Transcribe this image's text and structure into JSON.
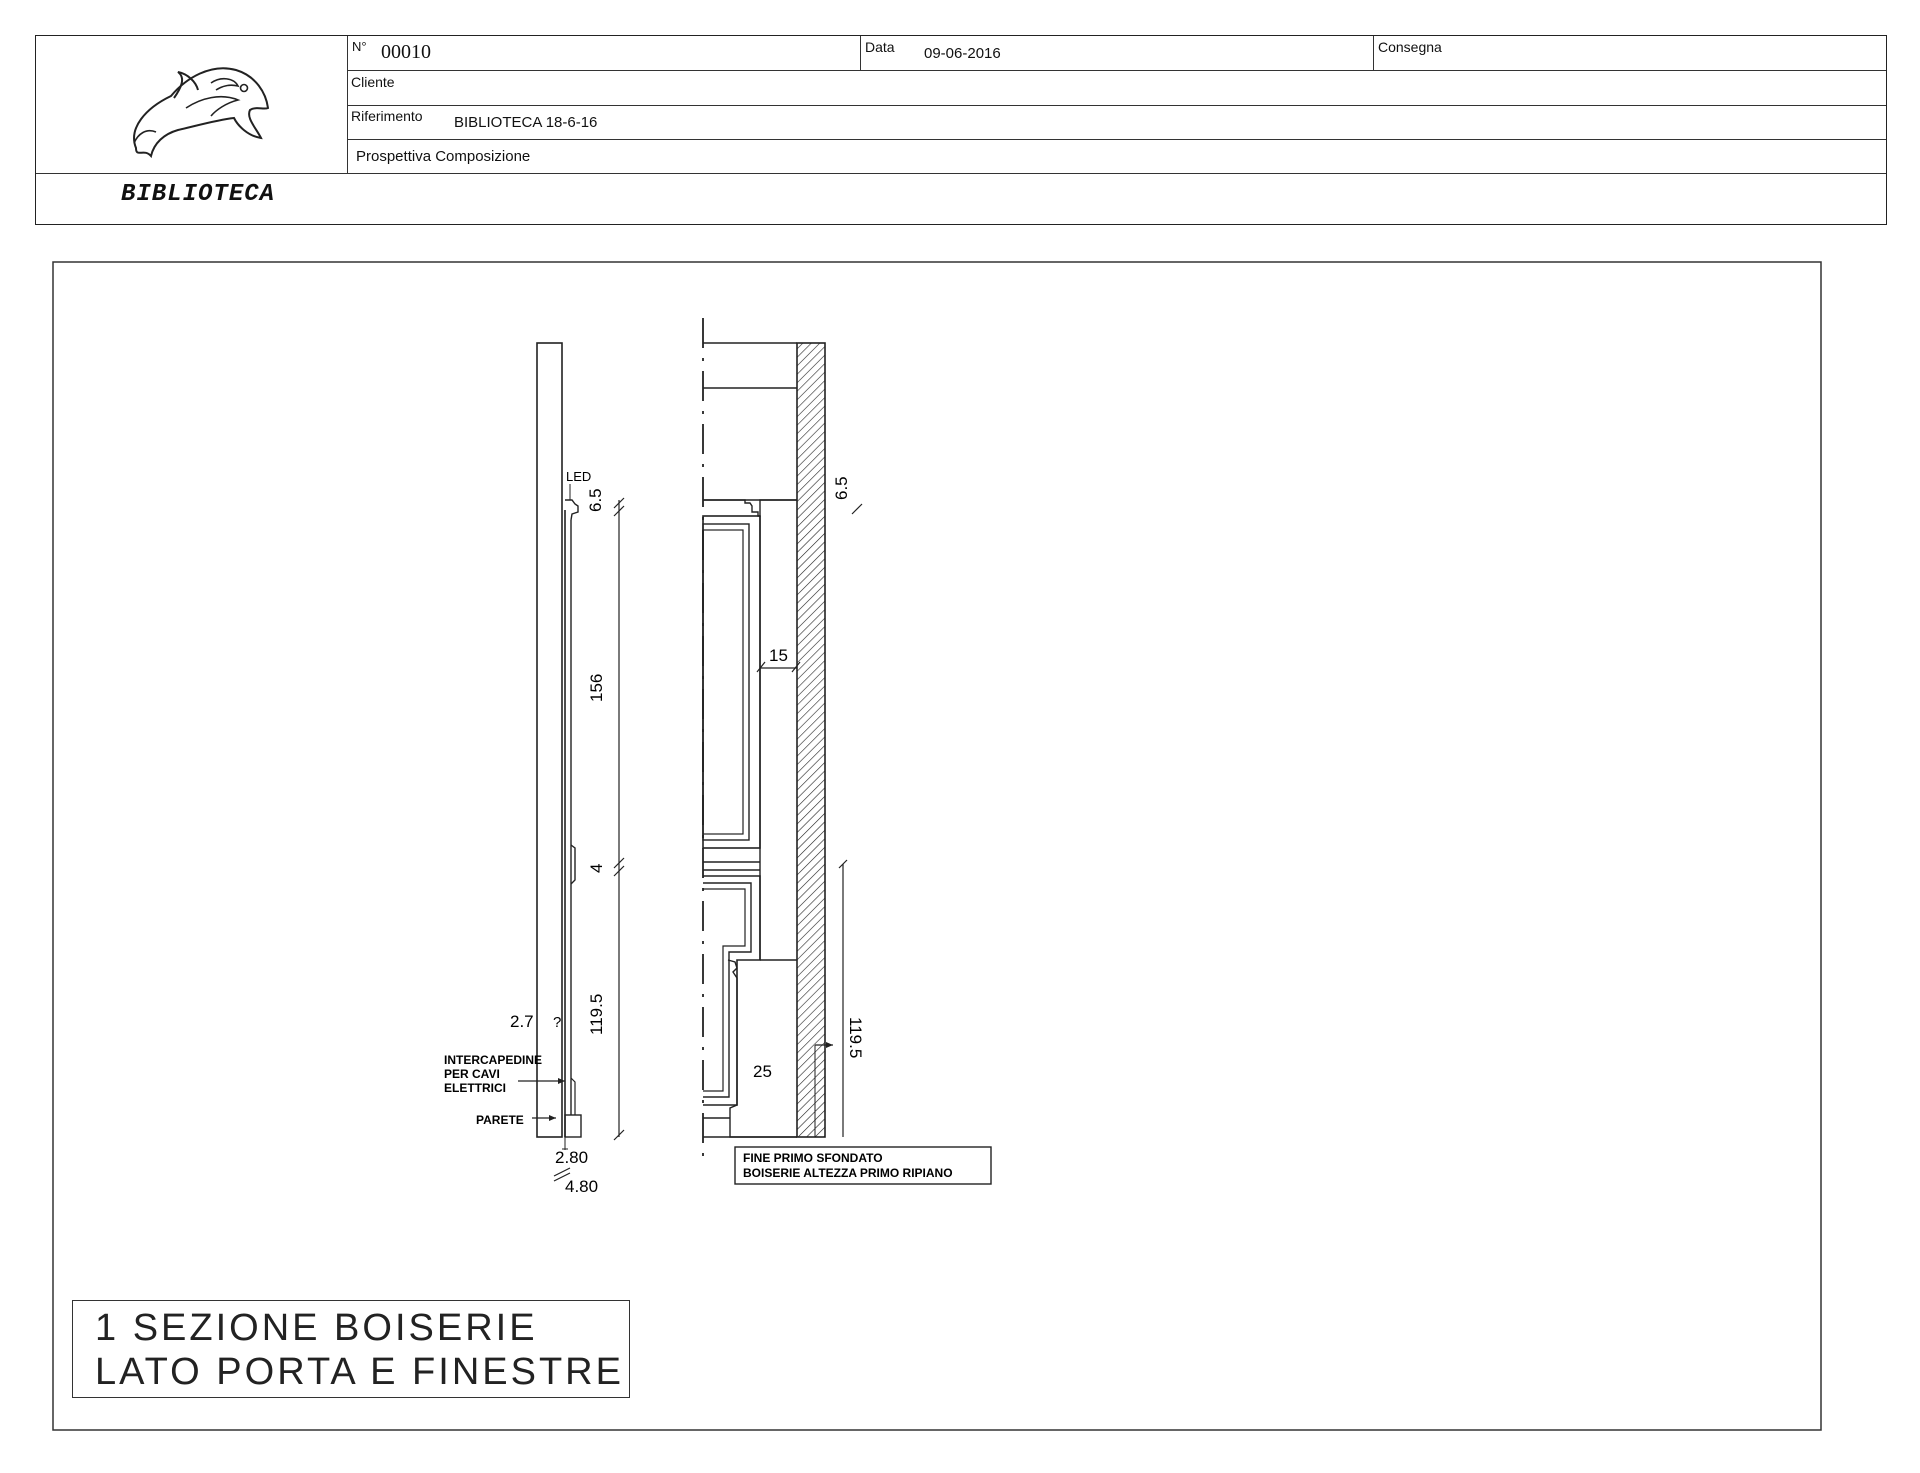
{
  "header": {
    "number_label": "N°",
    "number_value": "00010",
    "date_label": "Data",
    "date_value": "09-06-2016",
    "delivery_label": "Consegna",
    "delivery_value": "",
    "client_label": "Cliente",
    "client_value": "",
    "reference_label": "Riferimento",
    "reference_value": "BIBLIOTECA 18-6-16",
    "view_type": "Prospettiva Composizione",
    "project_title": "BIBLIOTECA",
    "logo": "dolphin-logo"
  },
  "left_section": {
    "led_label": "LED",
    "dim_top": "6.5",
    "dim_main": "156",
    "dim_mid": "4",
    "dim_lower": "119.5",
    "dim_side": "2.7",
    "dim_side_mark": "?",
    "cavity_label_1": "INTERCAPEDINE",
    "cavity_label_2": "PER CAVI",
    "cavity_label_3": "ELETTRICI",
    "wall_label": "PARETE",
    "dim_bottom_1": "2.80",
    "dim_bottom_2": "4.80"
  },
  "right_section": {
    "dim_top": "6.5",
    "dim_depth": "15",
    "dim_base": "25",
    "dim_lower": "119.5",
    "note_line_1": "FINE  PRIMO  SFONDATO",
    "note_line_2": "BOISERIE  ALTEZZA  PRIMO  RIPIANO"
  },
  "caption": {
    "line_1": "1  SEZIONE  BOISERIE",
    "line_2": "LATO  PORTA  E  FINESTRE"
  }
}
